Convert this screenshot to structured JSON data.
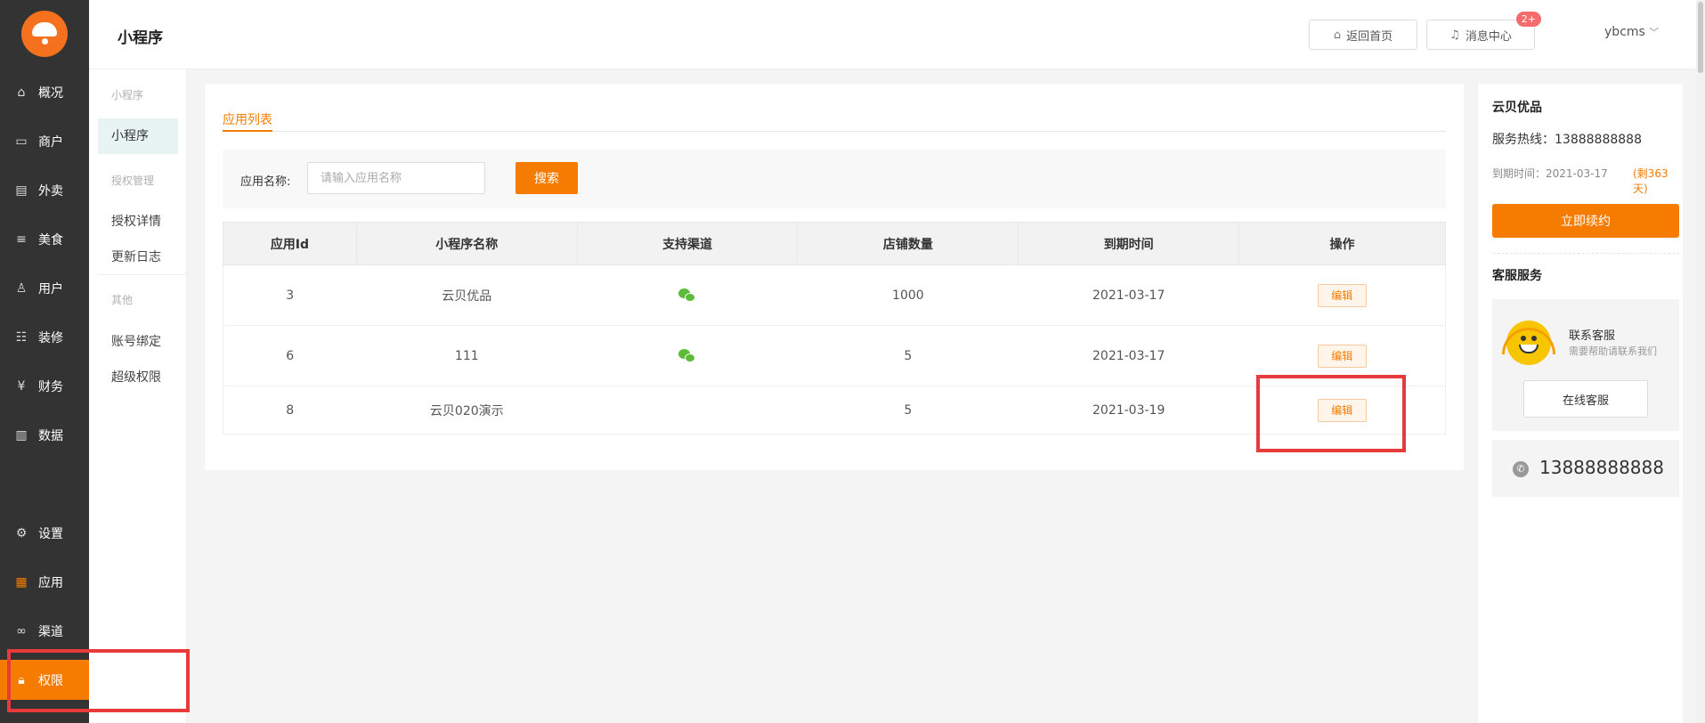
{
  "sidebar": {
    "items": [
      {
        "label": "概况",
        "icon": "home-icon"
      },
      {
        "label": "商户",
        "icon": "shop-icon"
      },
      {
        "label": "外卖",
        "icon": "document-icon"
      },
      {
        "label": "美食",
        "icon": "menu-icon"
      },
      {
        "label": "用户",
        "icon": "user-icon"
      },
      {
        "label": "装修",
        "icon": "decoration-icon"
      },
      {
        "label": "财务",
        "icon": "finance-icon"
      },
      {
        "label": "数据",
        "icon": "bar-chart-icon"
      }
    ],
    "bottom_items": [
      {
        "label": "设置",
        "icon": "gear-icon"
      },
      {
        "label": "应用",
        "icon": "apps-grid-icon"
      },
      {
        "label": "渠道",
        "icon": "link-icon"
      },
      {
        "label": "权限",
        "icon": "lock-icon",
        "active": true
      }
    ],
    "accent_color": "#f57c00"
  },
  "subnav": {
    "group1": "小程序",
    "item_active": "小程序",
    "group2": "授权管理",
    "items2": [
      "授权详情",
      "更新日志"
    ],
    "group3": "其他",
    "items3": [
      "账号绑定",
      "超级权限"
    ]
  },
  "header": {
    "title": "小程序",
    "home_button": "返回首页",
    "message_button": "消息中心",
    "message_badge": "2+",
    "user": "ybcms"
  },
  "main": {
    "tab": "应用列表",
    "search_label": "应用名称:",
    "search_placeholder": "请输入应用名称",
    "search_button": "搜索",
    "columns": [
      "应用Id",
      "小程序名称",
      "支持渠道",
      "店铺数量",
      "到期时间",
      "操作"
    ],
    "rows": [
      {
        "id": "3",
        "name": "云贝优品",
        "channel": "wechat",
        "shops": "1000",
        "expire": "2021-03-17",
        "action": "编辑"
      },
      {
        "id": "6",
        "name": "111",
        "channel": "wechat",
        "shops": "5",
        "expire": "2021-03-17",
        "action": "编辑"
      },
      {
        "id": "8",
        "name": "云贝020演示",
        "channel": "",
        "shops": "5",
        "expire": "2021-03-19",
        "action": "编辑"
      }
    ]
  },
  "rpanel": {
    "title": "云贝优品",
    "hotline": "服务热线：13888888888",
    "expire": "到期时间：2021-03-17",
    "remain": "(剩363天)",
    "renew_button": "立即续约",
    "cs_title": "客服服务",
    "cs_name": "联系客服",
    "cs_desc": "需要帮助请联系我们",
    "cs_online_button": "在线客服",
    "phone": "13888888888"
  }
}
